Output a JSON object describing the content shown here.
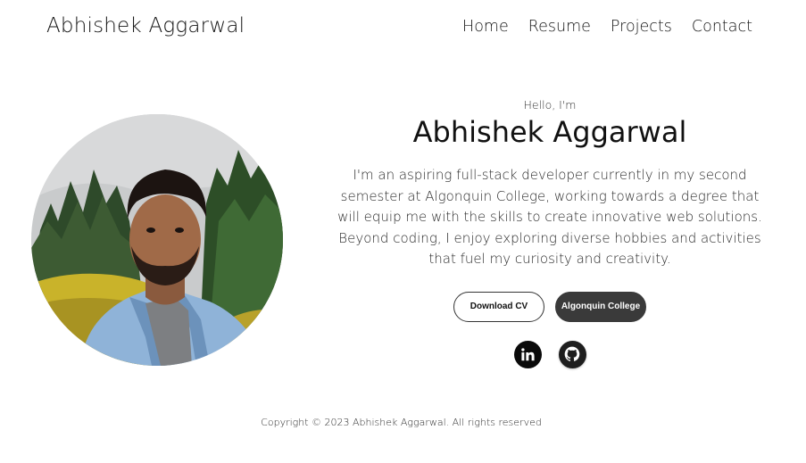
{
  "header": {
    "logo": "Abhishek Aggarwal",
    "nav": [
      {
        "label": "Home"
      },
      {
        "label": "Resume"
      },
      {
        "label": "Projects"
      },
      {
        "label": "Contact"
      }
    ]
  },
  "profile": {
    "greeting": "Hello, I'm",
    "name": "Abhishek Aggarwal",
    "bio": "I'm an aspiring full-stack developer currently in my second semester at Algonquin College, working towards a degree that will equip me with the skills to create innovative web solutions. Beyond coding, I enjoy exploring diverse hobbies and activities that fuel my curiosity and creativity.",
    "buttons": {
      "download_cv": "Download CV",
      "college": "Algonquin College"
    },
    "socials": [
      {
        "icon": "linkedin-icon"
      },
      {
        "icon": "github-icon"
      }
    ]
  },
  "footer": {
    "copyright": "Copyright © 2023 Abhishek Aggarwal. All rights reserved"
  },
  "colors": {
    "background": "#ffffff",
    "text": "#111111",
    "dark_button": "#3a3a3a"
  }
}
